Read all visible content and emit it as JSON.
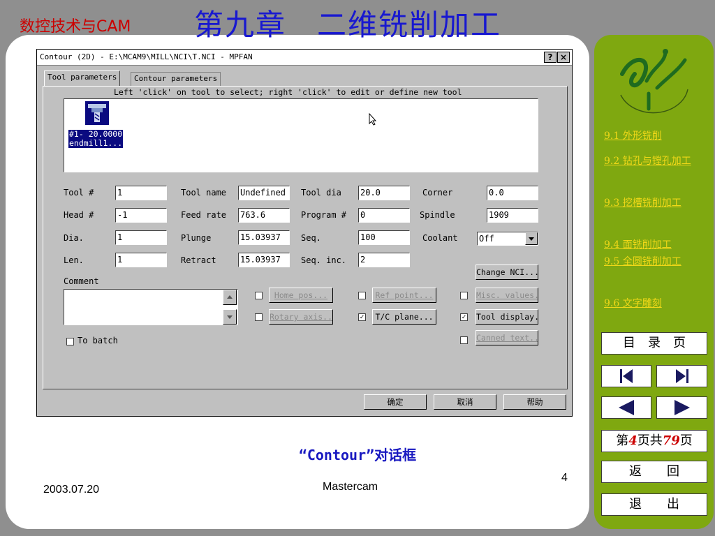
{
  "slide": {
    "course_title": "数控技术与CAM",
    "chapter_title": "第九章　二维铣削加工",
    "caption": "“Contour”对话框",
    "footer_date": "2003.07.20",
    "footer_app": "Mastercam",
    "page_number": "4"
  },
  "sidebar": {
    "toc": [
      "9.1 外形铣削",
      "9.2 钻孔与镗孔加工",
      "9.3 挖槽铣削加工",
      "9.4 面铣削加工",
      "9.5 全圆铣削加工",
      "9.6 文字雕刻"
    ],
    "toc_btn": "目　录　页",
    "page_info": {
      "prefix": "第",
      "current": "4",
      "mid": "页共",
      "total": "79",
      "suffix": "页"
    },
    "back_btn": "返　　回",
    "exit_btn": "退　　出"
  },
  "dialog": {
    "title": "Contour (2D) - E:\\MCAM9\\MILL\\NCI\\T.NCI - MPFAN",
    "help_btn": "?",
    "close_btn": "×",
    "tabs": [
      "Tool parameters",
      "Contour parameters"
    ],
    "hint": "Left 'click' on tool to select; right 'click' to edit or define new tool",
    "tool_item": "#1- 20.0000\nendmill1...",
    "fields": {
      "tool_num": {
        "label": "Tool #",
        "value": "1"
      },
      "head_num": {
        "label": "Head #",
        "value": "-1"
      },
      "dia": {
        "label": "Dia.",
        "value": "1"
      },
      "len": {
        "label": "Len.",
        "value": "1"
      },
      "tool_name": {
        "label": "Tool name",
        "value": "Undefined"
      },
      "feed_rate": {
        "label": "Feed rate",
        "value": "763.6"
      },
      "plunge": {
        "label": "Plunge",
        "value": "15.03937"
      },
      "retract": {
        "label": "Retract",
        "value": "15.03937"
      },
      "tool_dia": {
        "label": "Tool dia",
        "value": "20.0"
      },
      "program_num": {
        "label": "Program #",
        "value": "0"
      },
      "seq": {
        "label": "Seq.",
        "value": "100"
      },
      "seq_inc": {
        "label": "Seq. inc.",
        "value": "2"
      },
      "corner": {
        "label": "Corner",
        "value": "0.0"
      },
      "spindle": {
        "label": "Spindle",
        "value": "1909"
      },
      "coolant": {
        "label": "Coolant",
        "value": "Off"
      }
    },
    "comment_label": "Comment",
    "to_batch": "To batch",
    "buttons": {
      "change_nci": "Change NCI...",
      "home_pos": "Home pos...",
      "ref_point": "Ref point...",
      "misc_values": "Misc. values..",
      "rotary_axis": "Rotary axis..",
      "tc_plane": "T/C plane...",
      "tool_display": "Tool display..",
      "canned_text": "Canned text..",
      "ok": "确定",
      "cancel": "取消",
      "help": "帮助"
    },
    "checks": {
      "home_pos": false,
      "ref_point": false,
      "misc_values": false,
      "rotary_axis": false,
      "tc_plane": true,
      "tool_display": true,
      "canned_text": false,
      "to_batch": false
    }
  },
  "colors": {
    "background": "#8f8f8f",
    "panel_green": "#7fa810",
    "toc_yellow": "#f0d818",
    "title_blue": "#1818d0",
    "course_red": "#cc0000",
    "selection": "#0a0a80"
  }
}
